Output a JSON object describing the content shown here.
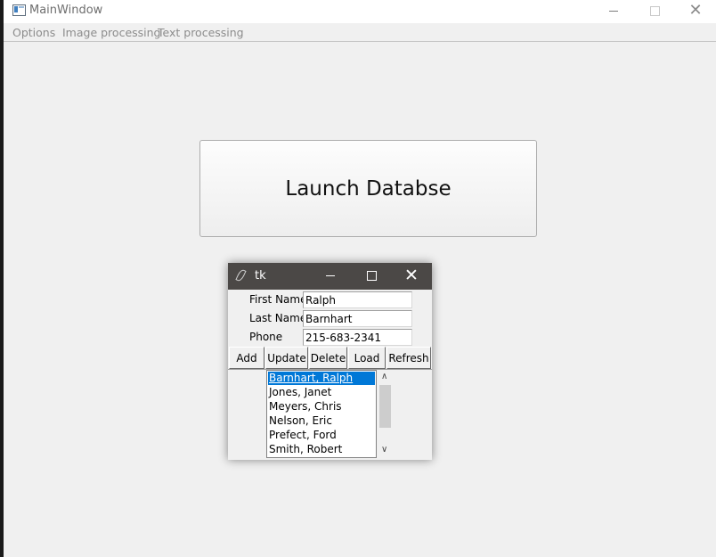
{
  "main_window": {
    "title": "MainWindow",
    "controls": {
      "minimize": "–",
      "maximize": "□",
      "close": "✕"
    },
    "menu": [
      {
        "label": "Options"
      },
      {
        "label": "Image processing"
      },
      {
        "label": "Text processing"
      }
    ],
    "launch_button_label": "Launch Databse",
    "icons": {
      "app": "app-window-icon"
    }
  },
  "tk_window": {
    "title": "tk",
    "controls": {
      "minimize": "–",
      "maximize": "□",
      "close": "✕"
    },
    "icons": {
      "app": "feather-icon"
    },
    "fields": {
      "first_name": {
        "label": "First Name",
        "value": "Ralph"
      },
      "last_name": {
        "label": "Last Name",
        "value": "Barnhart"
      },
      "phone": {
        "label": "Phone",
        "value": "215-683-2341"
      }
    },
    "buttons": {
      "add": "Add",
      "update": "Update",
      "delete": "Delete",
      "load": "Load",
      "refresh": "Refresh"
    },
    "listbox": {
      "items": [
        "Barnhart, Ralph",
        "Jones, Janet",
        "Meyers, Chris",
        "Nelson, Eric",
        "Prefect, Ford",
        "Smith, Robert"
      ],
      "selected_index": 0
    },
    "colors": {
      "title_bar": "#4b4846",
      "selection": "#0078d7"
    }
  }
}
